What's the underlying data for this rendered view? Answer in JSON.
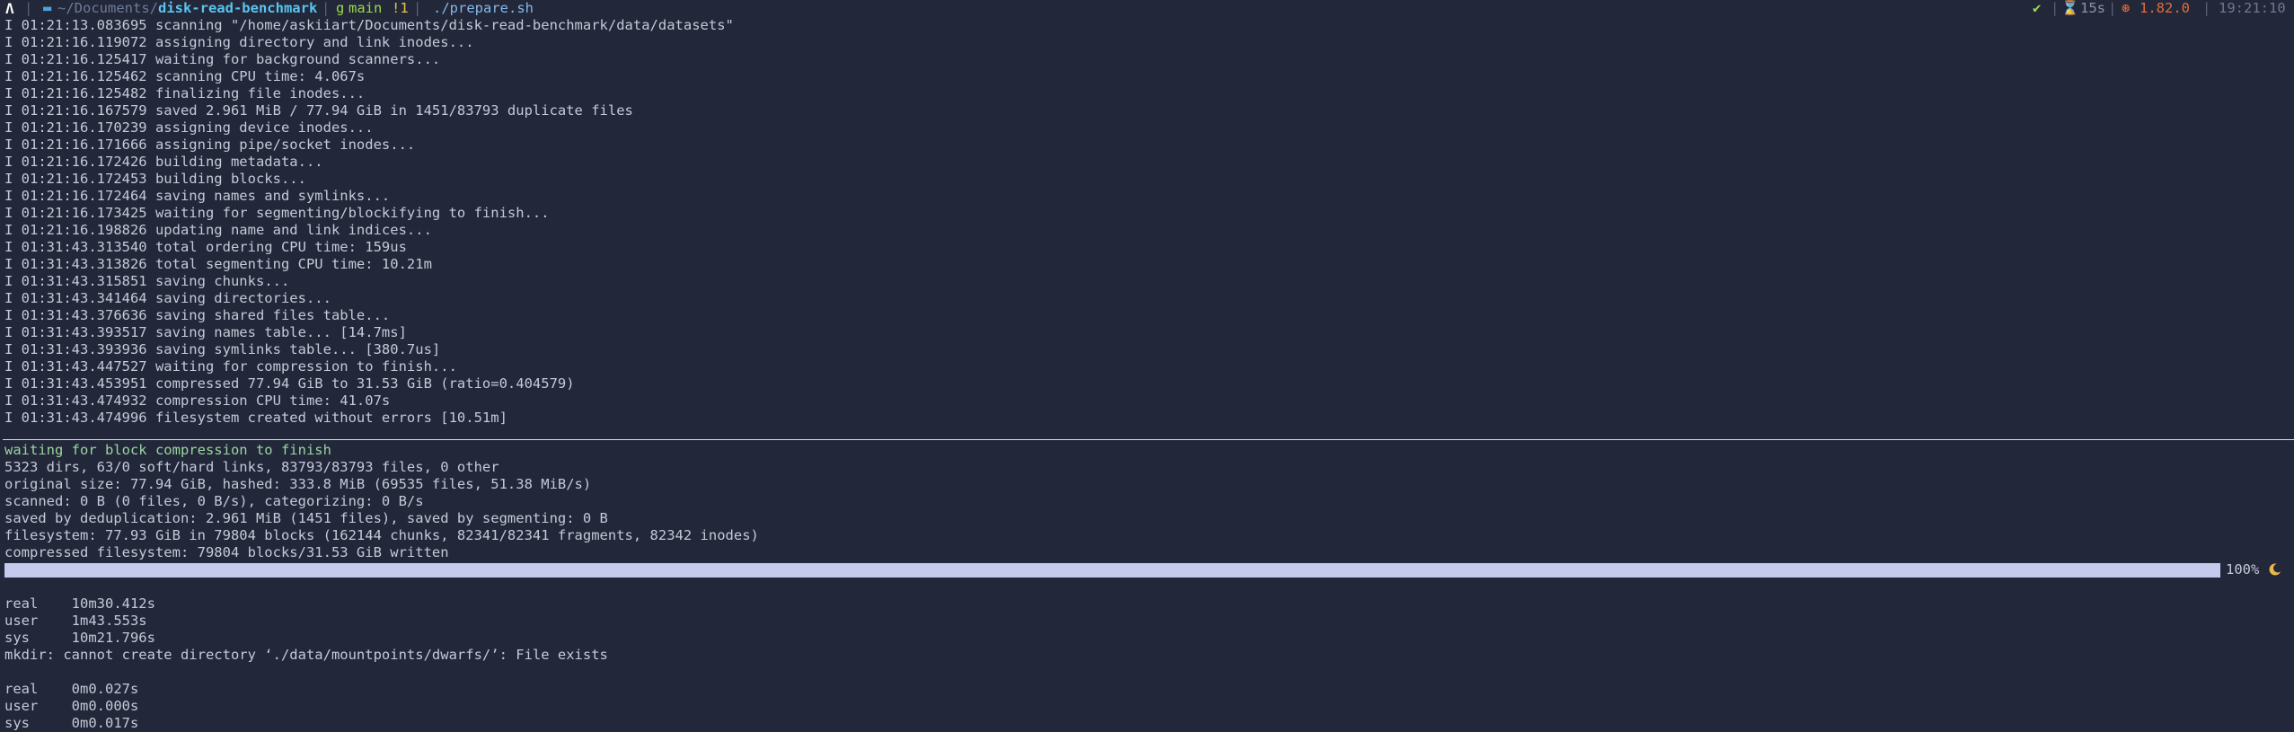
{
  "prompt": {
    "arch_glyph": "Λ",
    "folder_glyph": "▬",
    "path_prefix": "~/Documents/",
    "path_current": "disk-read-benchmark",
    "git_glyph": "g",
    "branch": "main",
    "git_status": "!1",
    "command": "./prepare.sh",
    "ok_glyph": "✔",
    "timer_glyph": "⌛",
    "duration": "15s",
    "rust_glyph": "⊛",
    "rust_version": "1.82.0",
    "clock": "19:21:10"
  },
  "log_lines": [
    "I 01:21:13.083695 scanning \"/home/askiiart/Documents/disk-read-benchmark/data/datasets\"",
    "I 01:21:16.119072 assigning directory and link inodes...",
    "I 01:21:16.125417 waiting for background scanners...",
    "I 01:21:16.125462 scanning CPU time: 4.067s",
    "I 01:21:16.125482 finalizing file inodes...",
    "I 01:21:16.167579 saved 2.961 MiB / 77.94 GiB in 1451/83793 duplicate files",
    "I 01:21:16.170239 assigning device inodes...",
    "I 01:21:16.171666 assigning pipe/socket inodes...",
    "I 01:21:16.172426 building metadata...",
    "I 01:21:16.172453 building blocks...",
    "I 01:21:16.172464 saving names and symlinks...",
    "I 01:21:16.173425 waiting for segmenting/blockifying to finish...",
    "I 01:21:16.198826 updating name and link indices...",
    "I 01:31:43.313540 total ordering CPU time: 159us",
    "I 01:31:43.313826 total segmenting CPU time: 10.21m",
    "I 01:31:43.315851 saving chunks...",
    "I 01:31:43.341464 saving directories...",
    "I 01:31:43.376636 saving shared files table...",
    "I 01:31:43.393517 saving names table... [14.7ms]",
    "I 01:31:43.393936 saving symlinks table... [380.7us]",
    "I 01:31:43.447527 waiting for compression to finish...",
    "I 01:31:43.453951 compressed 77.94 GiB to 31.53 GiB (ratio=0.404579)",
    "I 01:31:43.474932 compression CPU time: 41.07s",
    "I 01:31:43.474996 filesystem created without errors [10.51m]"
  ],
  "status": {
    "heading": "waiting for block compression to finish",
    "lines": [
      "5323 dirs, 63/0 soft/hard links, 83793/83793 files, 0 other",
      "original size: 77.94 GiB, hashed: 333.8 MiB (69535 files, 51.38 MiB/s)",
      "scanned: 0 B (0 files, 0 B/s), categorizing: 0 B/s",
      "saved by deduplication: 2.961 MiB (1451 files), saved by segmenting: 0 B",
      "filesystem: 77.93 GiB in 79804 blocks (162144 chunks, 82341/82341 fragments, 82342 inodes)",
      "compressed filesystem: 79804 blocks/31.53 GiB written"
    ]
  },
  "progress": {
    "fraction": 1.0,
    "label": "100%"
  },
  "timing1": [
    "real    10m30.412s",
    "user    1m43.553s",
    "sys     10m21.796s"
  ],
  "error_line": "mkdir: cannot create directory ‘./data/mountpoints/dwarfs/’: File exists",
  "timing2": [
    "real    0m0.027s",
    "user    0m0.000s",
    "sys     0m0.017s"
  ]
}
